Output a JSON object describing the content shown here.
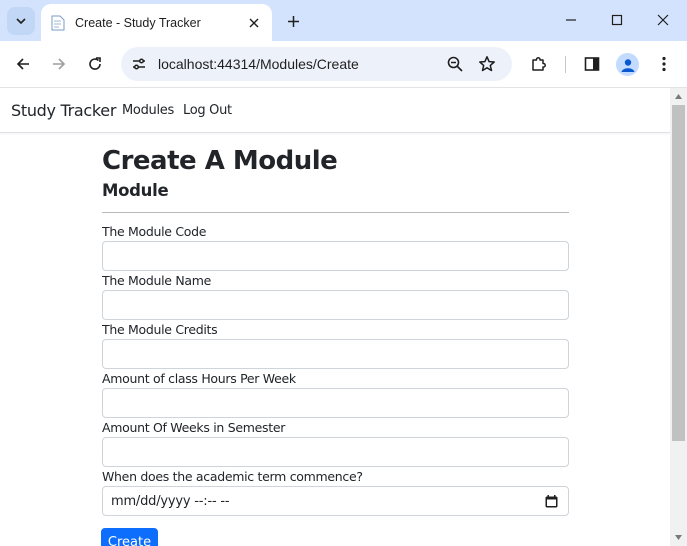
{
  "browser": {
    "tab_title": "Create - Study Tracker",
    "url": "localhost:44314/Modules/Create"
  },
  "icons": {
    "tab_search": "chevron-down-icon",
    "favicon": "page-icon",
    "tab_close": "close-icon",
    "new_tab": "plus-icon",
    "minimize": "minimize-icon",
    "maximize": "maximize-icon",
    "close_window": "close-icon",
    "back": "arrow-left-icon",
    "forward": "arrow-right-icon",
    "reload": "reload-icon",
    "site_info": "tune-icon",
    "zoom": "zoom-out-icon",
    "bookmark": "star-icon",
    "extensions": "puzzle-icon",
    "side_panel": "side-panel-icon",
    "profile": "person-icon",
    "menu": "kebab-menu-icon",
    "calendar": "calendar-icon"
  },
  "navbar": {
    "brand": "Study Tracker",
    "links": [
      "Modules",
      "Log Out"
    ]
  },
  "page": {
    "title": "Create A Module",
    "subtitle": "Module"
  },
  "form": {
    "fields": [
      {
        "label": "The Module Code",
        "value": ""
      },
      {
        "label": "The Module Name",
        "value": ""
      },
      {
        "label": "The Module Credits",
        "value": ""
      },
      {
        "label": "Amount of class Hours Per Week",
        "value": ""
      },
      {
        "label": "Amount Of Weeks in Semester",
        "value": ""
      }
    ],
    "start_label": "When does the academic term commence?",
    "start_value": "mm/dd/yyyy --:-- --",
    "submit_label": "Create"
  },
  "colors": {
    "tabstrip_bg": "#d3e3fd",
    "omnibox_bg": "#edf2fa",
    "primary_button": "#0d6efd",
    "text": "#212529"
  }
}
